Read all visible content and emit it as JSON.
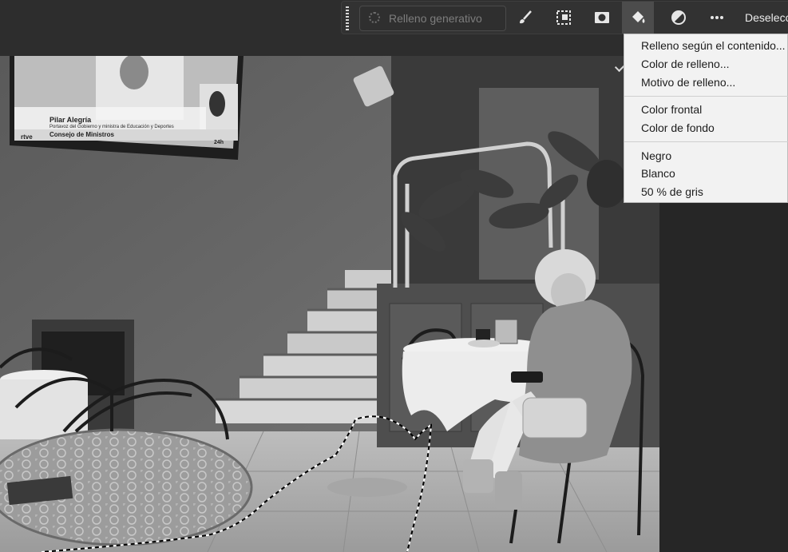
{
  "taskbar": {
    "generative_fill_label": "Relleno generativo",
    "deselect_label": "Deselecc",
    "buttons": [
      {
        "name": "brush-icon"
      },
      {
        "name": "transform-icon"
      },
      {
        "name": "mask-icon"
      },
      {
        "name": "paint-bucket-icon",
        "active": true
      },
      {
        "name": "adjustment-icon"
      },
      {
        "name": "more-icon"
      }
    ]
  },
  "fill_menu": {
    "items": [
      {
        "label": "Relleno según el contenido..."
      },
      {
        "label": "Color de relleno..."
      },
      {
        "label": "Motivo de relleno..."
      },
      {
        "label": "Color frontal"
      },
      {
        "label": "Color de fondo"
      },
      {
        "label": "Negro"
      },
      {
        "label": "Blanco"
      },
      {
        "label": "50 % de gris"
      }
    ]
  },
  "tv": {
    "name_line": "Pilar Alegría",
    "role_line": "Portavoz del Gobierno y ministra de Educación y Deportes",
    "program_line": "Consejo de Ministros",
    "channel_logo": "rtve",
    "news_badge": "24h"
  },
  "colors": {
    "taskbar_bg": "#323232",
    "menu_bg": "#f2f2f2",
    "active_button": "#4c4c4c"
  }
}
